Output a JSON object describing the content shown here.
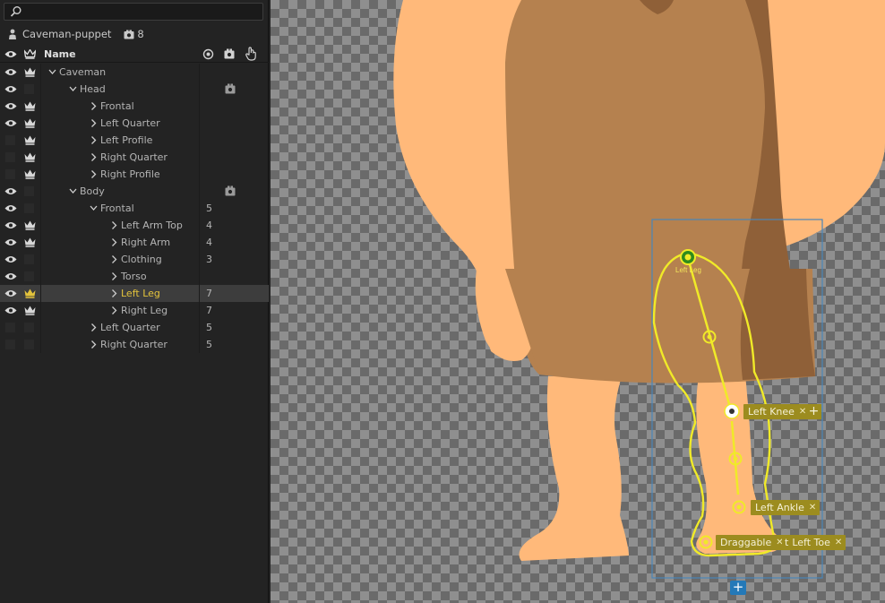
{
  "search": {
    "placeholder": "",
    "icon": "search-icon"
  },
  "puppet": {
    "name": "Caveman-puppet",
    "camera_count": "8"
  },
  "header": {
    "name_label": "Name"
  },
  "layers": [
    {
      "label": "Caveman",
      "indent": 0,
      "eye": true,
      "crown": true,
      "num": "",
      "cam": false,
      "selected": false
    },
    {
      "label": "Head",
      "indent": 1,
      "eye": true,
      "crown": false,
      "num": "",
      "cam": true,
      "selected": false
    },
    {
      "label": "Frontal",
      "indent": 2,
      "eye": true,
      "crown": true,
      "num": "",
      "cam": false,
      "selected": false
    },
    {
      "label": "Left Quarter",
      "indent": 2,
      "eye": true,
      "crown": true,
      "num": "",
      "cam": false,
      "selected": false
    },
    {
      "label": "Left Profile",
      "indent": 2,
      "eye": false,
      "crown": true,
      "num": "",
      "cam": false,
      "selected": false
    },
    {
      "label": "Right Quarter",
      "indent": 2,
      "eye": false,
      "crown": true,
      "num": "",
      "cam": false,
      "selected": false
    },
    {
      "label": "Right Profile",
      "indent": 2,
      "eye": false,
      "crown": true,
      "num": "",
      "cam": false,
      "selected": false
    },
    {
      "label": "Body",
      "indent": 1,
      "eye": true,
      "crown": false,
      "num": "",
      "cam": true,
      "selected": false
    },
    {
      "label": "Frontal",
      "indent": 2,
      "eye": true,
      "crown": false,
      "num": "5",
      "cam": false,
      "selected": false
    },
    {
      "label": "Left Arm Top",
      "indent": 3,
      "eye": true,
      "crown": true,
      "num": "4",
      "cam": false,
      "selected": false
    },
    {
      "label": "Right Arm",
      "indent": 3,
      "eye": true,
      "crown": true,
      "num": "4",
      "cam": false,
      "selected": false
    },
    {
      "label": "Clothing",
      "indent": 3,
      "eye": true,
      "crown": false,
      "num": "3",
      "cam": false,
      "selected": false
    },
    {
      "label": "Torso",
      "indent": 3,
      "eye": true,
      "crown": false,
      "num": "",
      "cam": false,
      "selected": false
    },
    {
      "label": "Left Leg",
      "indent": 3,
      "eye": true,
      "crown": true,
      "num": "7",
      "cam": false,
      "selected": true
    },
    {
      "label": "Right Leg",
      "indent": 3,
      "eye": true,
      "crown": true,
      "num": "7",
      "cam": false,
      "selected": false
    },
    {
      "label": "Left Quarter",
      "indent": 2,
      "eye": false,
      "crown": false,
      "num": "5",
      "cam": false,
      "selected": false
    },
    {
      "label": "Right Quarter",
      "indent": 2,
      "eye": false,
      "crown": false,
      "num": "5",
      "cam": false,
      "selected": false
    }
  ],
  "canvas": {
    "origin_label": "Left Leg",
    "handles": {
      "knee": "Left Knee",
      "ankle": "Left Ankle",
      "draggable": "Draggable",
      "toe": "Left Toe",
      "toe_prefix": "t"
    },
    "add_symbol": "+",
    "remove_symbol": "✕"
  },
  "colors": {
    "skin": "#ffb97a",
    "tunic": "#b5814f",
    "tunic_shadow": "#8f6038",
    "handle_yellow": "#f0ea28",
    "tag_bg": "#9c8c1f",
    "selected_text": "#e3c33c",
    "bounds_blue": "#4a86b8"
  }
}
